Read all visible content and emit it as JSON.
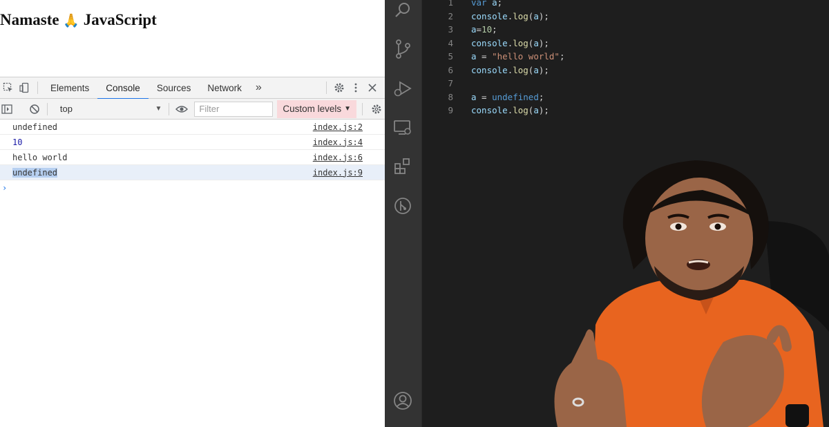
{
  "page": {
    "heading_before": "Namaste",
    "heading_emoji": "🙏",
    "heading_after": "JavaScript"
  },
  "devtools": {
    "tabs": [
      {
        "label": "Elements",
        "active": false
      },
      {
        "label": "Console",
        "active": true
      },
      {
        "label": "Sources",
        "active": false
      },
      {
        "label": "Network",
        "active": false
      }
    ],
    "more_label": "»",
    "context_selector": "top",
    "filter_placeholder": "Filter",
    "levels_label": "Custom levels",
    "console_rows": [
      {
        "message": "undefined",
        "source": "index.js:2",
        "kind": "plain",
        "selected": false
      },
      {
        "message": "10",
        "source": "index.js:4",
        "kind": "number",
        "selected": false
      },
      {
        "message": "hello world",
        "source": "index.js:6",
        "kind": "plain",
        "selected": false
      },
      {
        "message": "undefined",
        "source": "index.js:9",
        "kind": "plain",
        "selected": true
      }
    ],
    "prompt_symbol": "›"
  },
  "editor": {
    "activity_icons": [
      "search-icon",
      "source-control-icon",
      "run-debug-icon",
      "remote-explorer-icon",
      "extensions-icon",
      "git-graph-icon",
      "account-icon"
    ],
    "code_lines": [
      {
        "num": "1",
        "tokens": [
          {
            "t": "var",
            "c": "kw"
          },
          {
            "t": " ",
            "c": "pn"
          },
          {
            "t": "a",
            "c": "vr"
          },
          {
            "t": ";",
            "c": "pn"
          }
        ]
      },
      {
        "num": "2",
        "tokens": [
          {
            "t": "console",
            "c": "vr"
          },
          {
            "t": ".",
            "c": "pn"
          },
          {
            "t": "log",
            "c": "fn"
          },
          {
            "t": "(",
            "c": "pn"
          },
          {
            "t": "a",
            "c": "vr"
          },
          {
            "t": ");",
            "c": "pn"
          }
        ]
      },
      {
        "num": "3",
        "tokens": [
          {
            "t": "a",
            "c": "vr"
          },
          {
            "t": "=",
            "c": "pn"
          },
          {
            "t": "10",
            "c": "nm"
          },
          {
            "t": ";",
            "c": "pn"
          }
        ]
      },
      {
        "num": "4",
        "tokens": [
          {
            "t": "console",
            "c": "vr"
          },
          {
            "t": ".",
            "c": "pn"
          },
          {
            "t": "log",
            "c": "fn"
          },
          {
            "t": "(",
            "c": "pn"
          },
          {
            "t": "a",
            "c": "vr"
          },
          {
            "t": ");",
            "c": "pn"
          }
        ]
      },
      {
        "num": "5",
        "tokens": [
          {
            "t": "a",
            "c": "vr"
          },
          {
            "t": " = ",
            "c": "pn"
          },
          {
            "t": "\"hello world\"",
            "c": "st"
          },
          {
            "t": ";",
            "c": "pn"
          }
        ]
      },
      {
        "num": "6",
        "tokens": [
          {
            "t": "console",
            "c": "vr"
          },
          {
            "t": ".",
            "c": "pn"
          },
          {
            "t": "log",
            "c": "fn"
          },
          {
            "t": "(",
            "c": "pn"
          },
          {
            "t": "a",
            "c": "vr"
          },
          {
            "t": ");",
            "c": "pn"
          }
        ]
      },
      {
        "num": "7",
        "tokens": []
      },
      {
        "num": "8",
        "tokens": [
          {
            "t": "a",
            "c": "vr"
          },
          {
            "t": " = ",
            "c": "pn"
          },
          {
            "t": "undefined",
            "c": "kw"
          },
          {
            "t": ";",
            "c": "pn"
          }
        ]
      },
      {
        "num": "9",
        "tokens": [
          {
            "t": "console",
            "c": "vr"
          },
          {
            "t": ".",
            "c": "pn"
          },
          {
            "t": "log",
            "c": "fn"
          },
          {
            "t": "(",
            "c": "pn"
          },
          {
            "t": "a",
            "c": "vr"
          },
          {
            "t": ");",
            "c": "pn"
          }
        ]
      }
    ]
  },
  "colors": {
    "editor_bg": "#1e1e1e",
    "activity_bar_bg": "#333333",
    "devtools_active_tab": "#1a73e8",
    "custom_levels_bg": "#f9d9dc",
    "presenter_shirt": "#e8641f"
  }
}
